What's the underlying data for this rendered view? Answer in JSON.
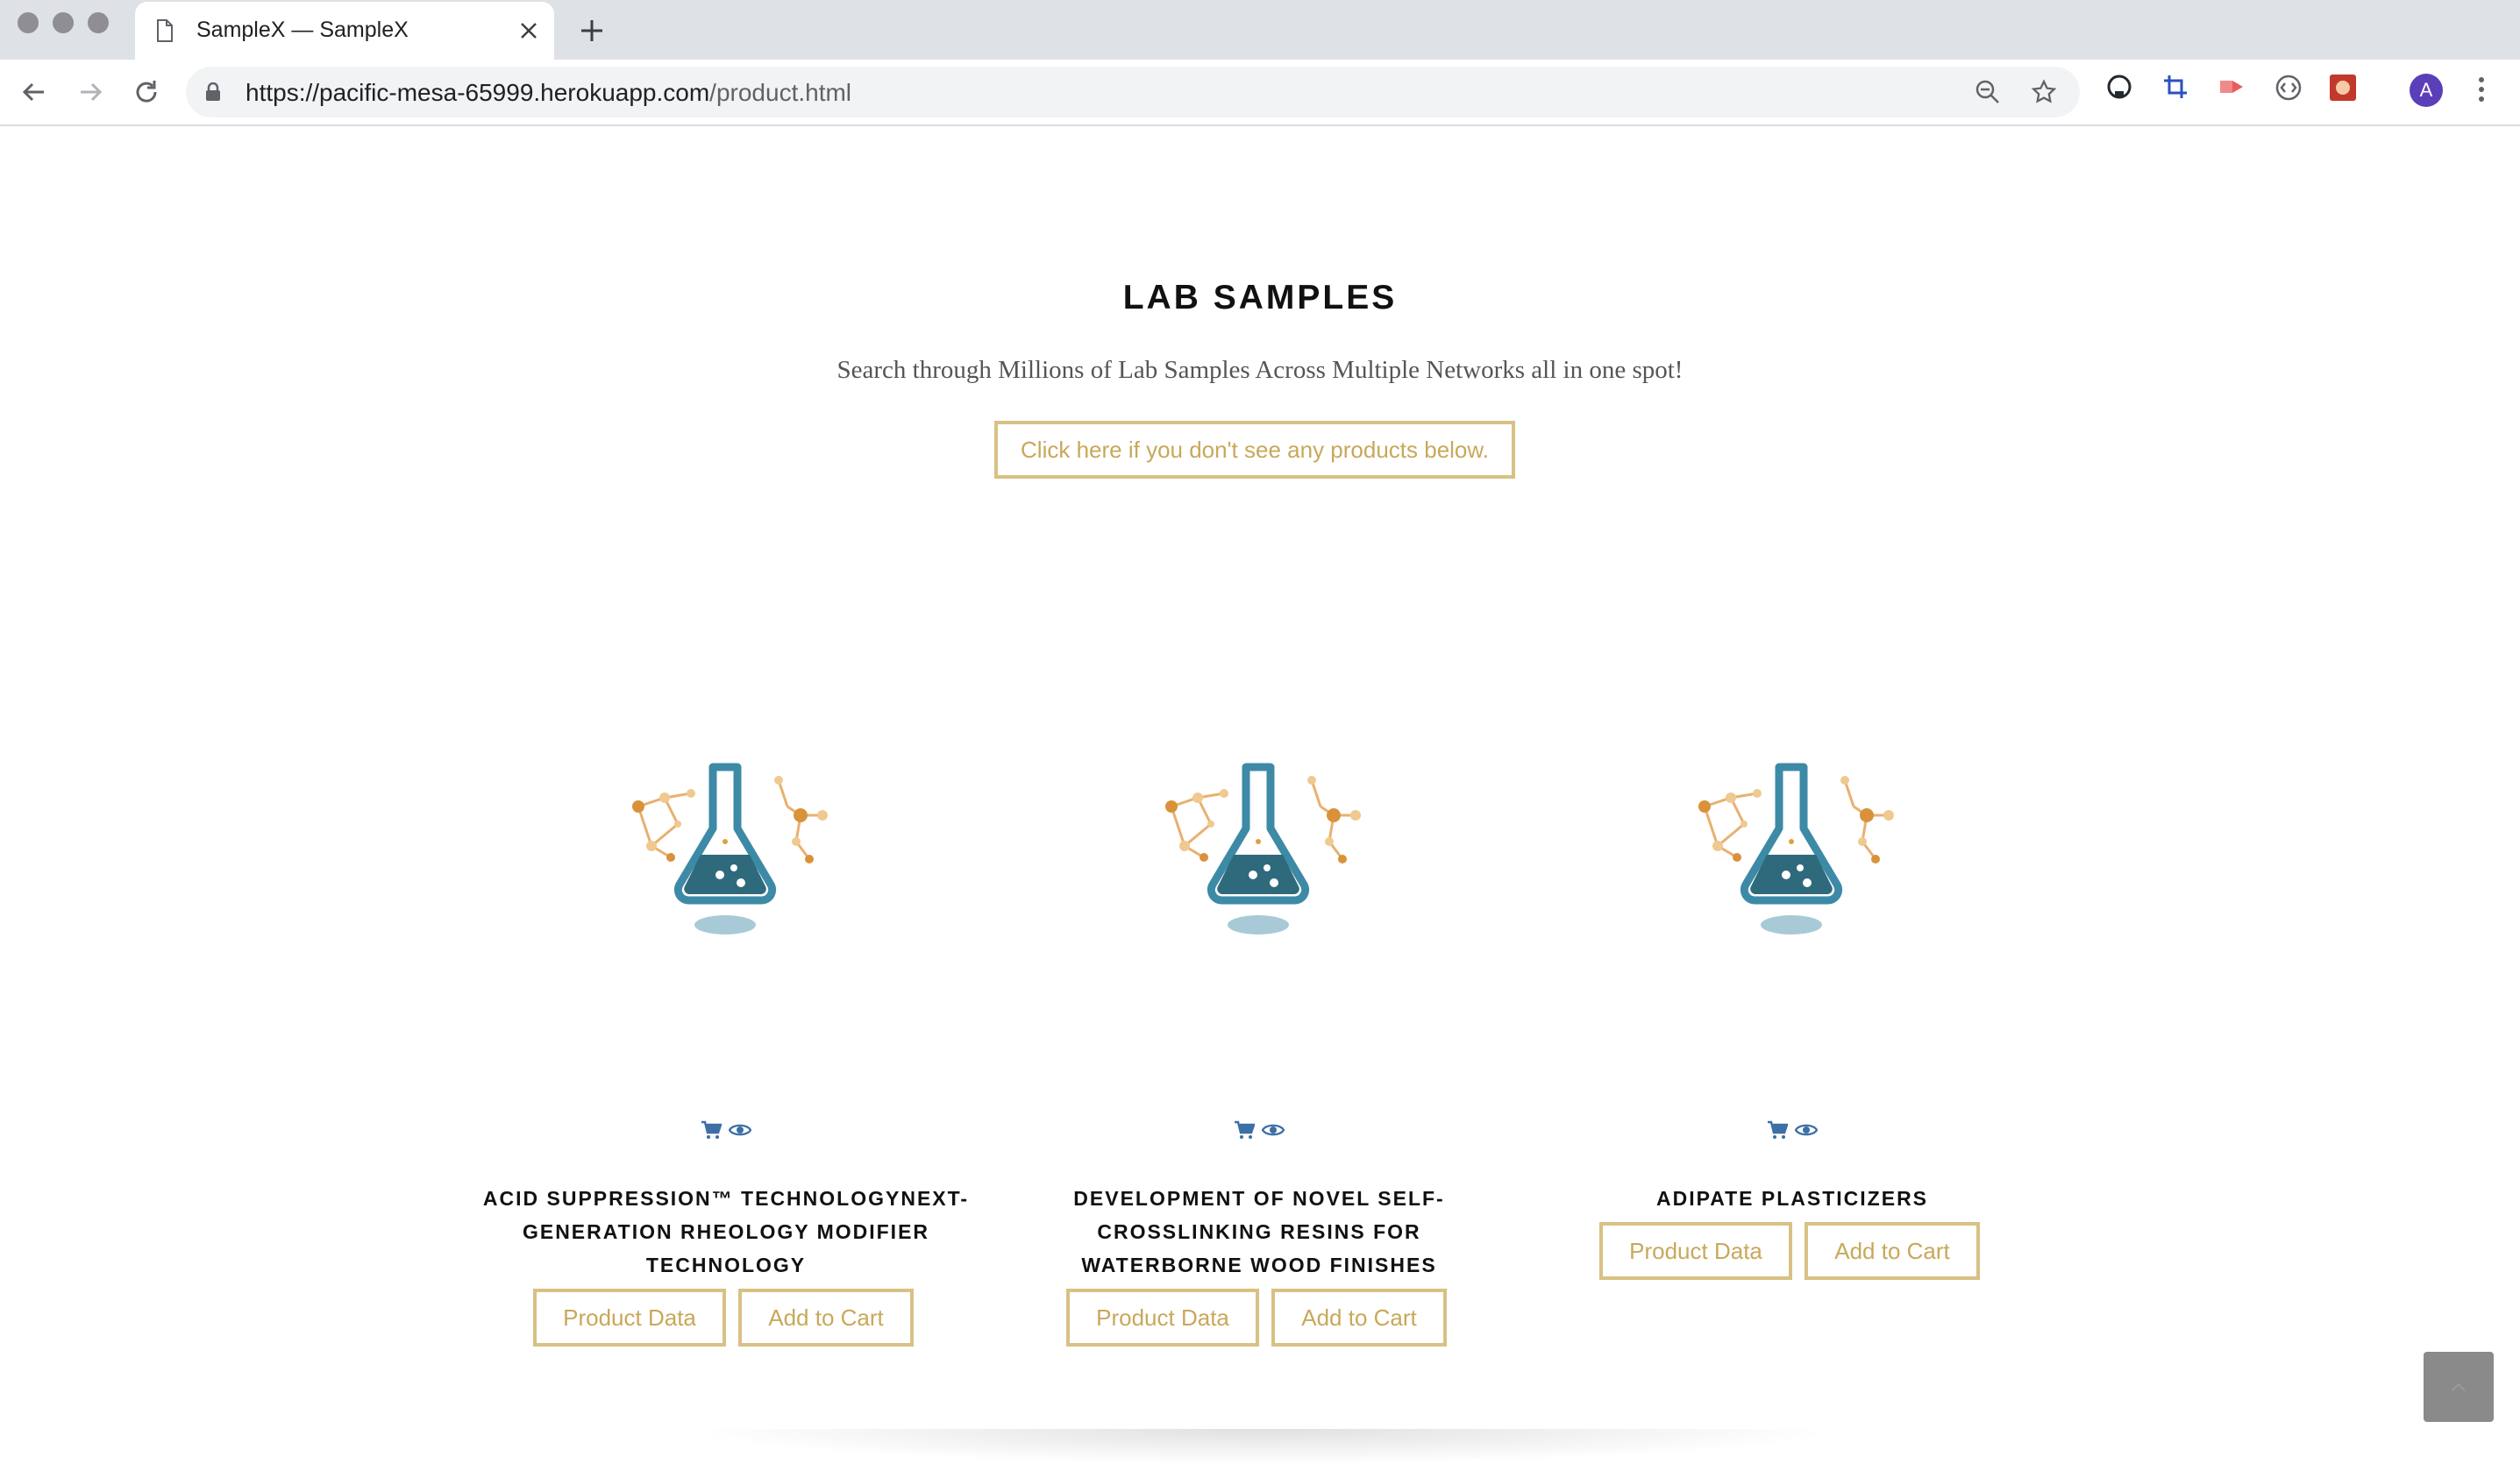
{
  "browser": {
    "tab_title": "SampleX — SampleX",
    "url_host": "https://pacific-mesa-65999.herokuapp.com",
    "url_path": "/product.html",
    "avatar_letter": "A"
  },
  "page": {
    "title": "LAB SAMPLES",
    "subtitle": "Search through Millions of Lab Samples Across Multiple Networks all in one spot!",
    "cta_label": "Click here if you don't see any products below."
  },
  "products": [
    {
      "title": "ACID SUPPRESSION™ TECHNOLOGYNEXT-GENERATION RHEOLOGY MODIFIER TECHNOLOGY",
      "data_label": "Product Data",
      "cart_label": "Add to Cart"
    },
    {
      "title": "DEVELOPMENT OF NOVEL SELF-CROSSLINKING RESINS FOR WATERBORNE WOOD FINISHES",
      "data_label": "Product Data",
      "cart_label": "Add to Cart"
    },
    {
      "title": "ADIPATE PLASTICIZERS",
      "data_label": "Product Data",
      "cart_label": "Add to Cart"
    }
  ],
  "colors": {
    "accent_gold": "#d8c184",
    "flask_teal": "#3d8aa6",
    "molecule_orange": "#e0a040"
  }
}
